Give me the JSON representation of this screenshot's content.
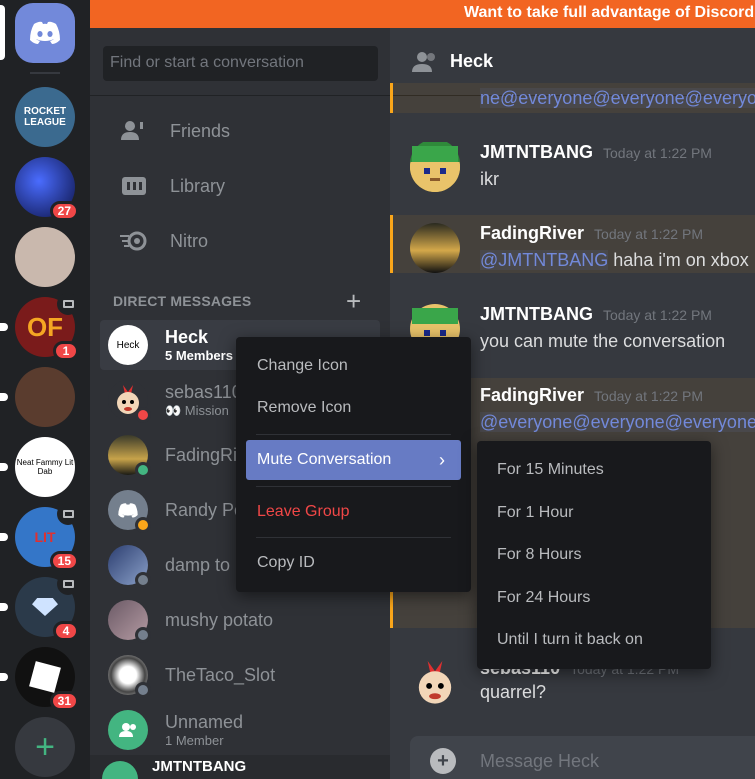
{
  "banner": {
    "text": "Want to take full advantage of Discord w"
  },
  "servers": [
    {
      "name": "ROCKET LEAGUE",
      "color": "#3b6a8f",
      "badge": "",
      "voice": false,
      "unread": false
    },
    {
      "name": "",
      "color": "#1c2f8a",
      "badge": "27",
      "voice": false,
      "unread": false
    },
    {
      "name": "",
      "color": "#c9b8ad",
      "badge": "",
      "voice": false,
      "unread": false
    },
    {
      "name": "OF",
      "color": "#7a1b1b",
      "badge": "1",
      "voice": true,
      "unread": true
    },
    {
      "name": "",
      "color": "#5a3c2e",
      "badge": "",
      "voice": false,
      "unread": true
    },
    {
      "name": "Neat Fammy Lit Dab",
      "color": "#ffffff",
      "badge": "",
      "voice": false,
      "unread": true
    },
    {
      "name": "LIT",
      "color": "#3476c8",
      "badge": "15",
      "voice": true,
      "unread": true
    },
    {
      "name": "",
      "color": "#2b3a4a",
      "badge": "4",
      "voice": true,
      "unread": true
    },
    {
      "name": "",
      "color": "#111111",
      "badge": "31",
      "voice": false,
      "unread": true
    }
  ],
  "search": {
    "placeholder": "Find or start a conversation"
  },
  "nav": {
    "friends": "Friends",
    "library": "Library",
    "nitro": "Nitro"
  },
  "dm_header": "DIRECT MESSAGES",
  "dms": [
    {
      "name": "Heck",
      "sub": "5 Members",
      "avatar_text": "Heck"
    },
    {
      "name": "sebas110",
      "sub": "👀 Mission"
    },
    {
      "name": "FadingRi",
      "sub": ""
    },
    {
      "name": "Randy Po",
      "sub": ""
    },
    {
      "name": "damp to",
      "sub": ""
    },
    {
      "name": "mushy potato",
      "sub": ""
    },
    {
      "name": "TheTaco_Slot",
      "sub": ""
    },
    {
      "name": "Unnamed",
      "sub": "1 Member"
    }
  ],
  "self": {
    "name": "JMTNTBANG"
  },
  "chat": {
    "title": "Heck",
    "messages": [
      {
        "text": "ne@everyone@everyone@everyone"
      },
      {
        "author": "JMTNTBANG",
        "time": "Today at 1:22 PM",
        "text": "ikr"
      },
      {
        "author": "FadingRiver",
        "time": "Today at 1:22 PM",
        "mention": "@JMTNTBANG",
        "text": " haha i'm on xbox"
      },
      {
        "author": "JMTNTBANG",
        "time": "Today at 1:22 PM",
        "text": "you can mute the conversation"
      },
      {
        "author": "FadingRiver",
        "time": "Today at 1:22 PM",
        "text": "@everyone@everyone@everyone"
      },
      {
        "author": "sebas110",
        "time": "Today at 1:22 PM",
        "text": "quarrel?"
      }
    ],
    "composer_placeholder": "Message Heck"
  },
  "context_menu": {
    "change_icon": "Change Icon",
    "remove_icon": "Remove Icon",
    "mute": "Mute Conversation",
    "leave": "Leave Group",
    "copy_id": "Copy ID"
  },
  "mute_menu": [
    "For 15 Minutes",
    "For 1 Hour",
    "For 8 Hours",
    "For 24 Hours",
    "Until I turn it back on"
  ],
  "colors": {
    "accent": "#7289da",
    "danger": "#f04747",
    "online": "#43b581",
    "idle": "#faa61a",
    "banner": "#f26522"
  }
}
